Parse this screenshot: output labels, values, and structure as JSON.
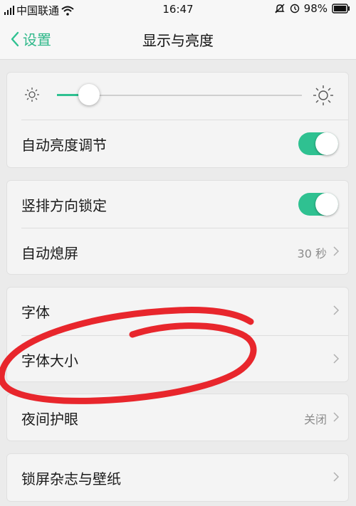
{
  "status_bar": {
    "carrier": "中国联通",
    "time": "16:47",
    "battery": "98%"
  },
  "nav": {
    "back_label": "设置",
    "title": "显示与亮度"
  },
  "brightness": {
    "level": 0.13,
    "auto_label": "自动亮度调节",
    "auto_on": true
  },
  "rows": {
    "portrait_lock": {
      "label": "竖排方向锁定",
      "on": true
    },
    "auto_sleep": {
      "label": "自动熄屏",
      "value": "30 秒"
    },
    "font": {
      "label": "字体"
    },
    "font_size": {
      "label": "字体大小"
    },
    "night_mode": {
      "label": "夜间护眼",
      "value": "关闭"
    },
    "lock_screen": {
      "label": "锁屏杂志与壁纸"
    }
  },
  "colors": {
    "accent": "#2fc191",
    "annotation": "#e8262c"
  }
}
